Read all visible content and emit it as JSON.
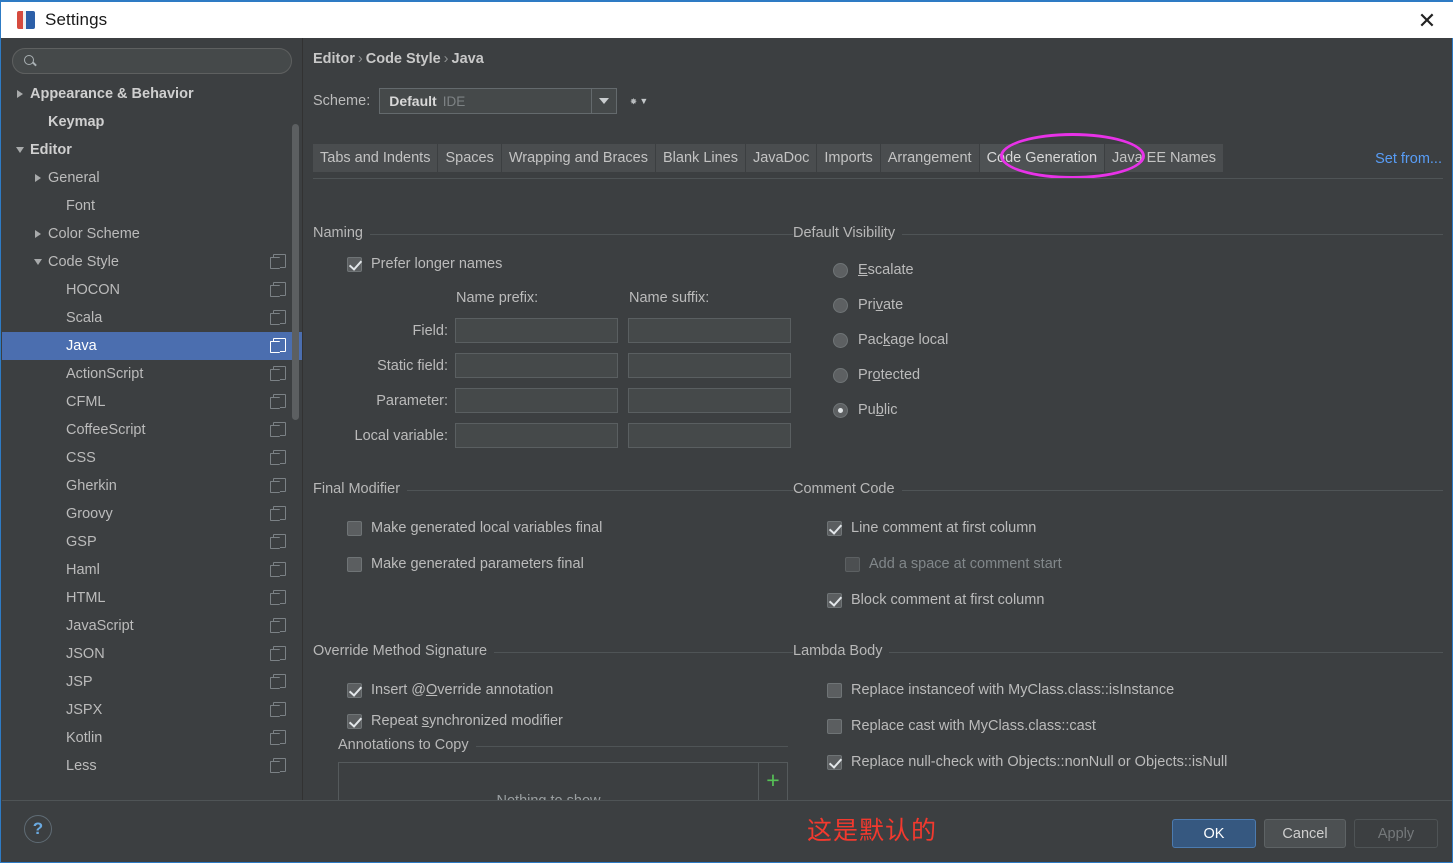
{
  "window": {
    "title": "Settings",
    "close_icon": "close-icon",
    "app_icon": "intellij-logo"
  },
  "sidebar": {
    "search": {
      "value": "",
      "placeholder": "",
      "icon": "search-icon"
    },
    "items": [
      {
        "label": "Appearance & Behavior",
        "indent": 0,
        "arrow": "right",
        "bold": true,
        "copy": false,
        "selected": false
      },
      {
        "label": "Keymap",
        "indent": 1,
        "arrow": "none",
        "bold": true,
        "copy": false,
        "selected": false
      },
      {
        "label": "Editor",
        "indent": 0,
        "arrow": "down",
        "bold": true,
        "copy": false,
        "selected": false
      },
      {
        "label": "General",
        "indent": 1,
        "arrow": "right",
        "bold": false,
        "copy": false,
        "selected": false
      },
      {
        "label": "Font",
        "indent": 2,
        "arrow": "none",
        "bold": false,
        "copy": false,
        "selected": false
      },
      {
        "label": "Color Scheme",
        "indent": 1,
        "arrow": "right",
        "bold": false,
        "copy": false,
        "selected": false
      },
      {
        "label": "Code Style",
        "indent": 1,
        "arrow": "down",
        "bold": false,
        "copy": true,
        "selected": false
      },
      {
        "label": "HOCON",
        "indent": 2,
        "arrow": "none",
        "bold": false,
        "copy": true,
        "selected": false
      },
      {
        "label": "Scala",
        "indent": 2,
        "arrow": "none",
        "bold": false,
        "copy": true,
        "selected": false
      },
      {
        "label": "Java",
        "indent": 2,
        "arrow": "none",
        "bold": false,
        "copy": true,
        "selected": true
      },
      {
        "label": "ActionScript",
        "indent": 2,
        "arrow": "none",
        "bold": false,
        "copy": true,
        "selected": false
      },
      {
        "label": "CFML",
        "indent": 2,
        "arrow": "none",
        "bold": false,
        "copy": true,
        "selected": false
      },
      {
        "label": "CoffeeScript",
        "indent": 2,
        "arrow": "none",
        "bold": false,
        "copy": true,
        "selected": false
      },
      {
        "label": "CSS",
        "indent": 2,
        "arrow": "none",
        "bold": false,
        "copy": true,
        "selected": false
      },
      {
        "label": "Gherkin",
        "indent": 2,
        "arrow": "none",
        "bold": false,
        "copy": true,
        "selected": false
      },
      {
        "label": "Groovy",
        "indent": 2,
        "arrow": "none",
        "bold": false,
        "copy": true,
        "selected": false
      },
      {
        "label": "GSP",
        "indent": 2,
        "arrow": "none",
        "bold": false,
        "copy": true,
        "selected": false
      },
      {
        "label": "Haml",
        "indent": 2,
        "arrow": "none",
        "bold": false,
        "copy": true,
        "selected": false
      },
      {
        "label": "HTML",
        "indent": 2,
        "arrow": "none",
        "bold": false,
        "copy": true,
        "selected": false
      },
      {
        "label": "JavaScript",
        "indent": 2,
        "arrow": "none",
        "bold": false,
        "copy": true,
        "selected": false
      },
      {
        "label": "JSON",
        "indent": 2,
        "arrow": "none",
        "bold": false,
        "copy": true,
        "selected": false
      },
      {
        "label": "JSP",
        "indent": 2,
        "arrow": "none",
        "bold": false,
        "copy": true,
        "selected": false
      },
      {
        "label": "JSPX",
        "indent": 2,
        "arrow": "none",
        "bold": false,
        "copy": true,
        "selected": false
      },
      {
        "label": "Kotlin",
        "indent": 2,
        "arrow": "none",
        "bold": false,
        "copy": true,
        "selected": false
      },
      {
        "label": "Less",
        "indent": 2,
        "arrow": "none",
        "bold": false,
        "copy": true,
        "selected": false
      }
    ]
  },
  "header": {
    "breadcrumb": [
      "Editor",
      "Code Style",
      "Java"
    ],
    "breadcrumb_separator": "›",
    "scheme_label": "Scheme:",
    "scheme_value": "Default",
    "scheme_scope": "IDE",
    "gear_icon": "gear-icon",
    "set_from_link": "Set from..."
  },
  "tabs": [
    {
      "label": "Tabs and Indents",
      "active": false
    },
    {
      "label": "Spaces",
      "active": false
    },
    {
      "label": "Wrapping and Braces",
      "active": false
    },
    {
      "label": "Blank Lines",
      "active": false
    },
    {
      "label": "JavaDoc",
      "active": false
    },
    {
      "label": "Imports",
      "active": false
    },
    {
      "label": "Arrangement",
      "active": false
    },
    {
      "label": "Code Generation",
      "active": true
    },
    {
      "label": "Java EE Names",
      "active": false
    }
  ],
  "annotation": {
    "highlight_color": "#e832e8",
    "tab_highlighted": "Code Generation"
  },
  "naming": {
    "group_title": "Naming",
    "prefer_longer_names": {
      "label": "Prefer longer names",
      "checked": true
    },
    "col_prefix": "Name prefix:",
    "col_suffix": "Name suffix:",
    "rows": [
      {
        "label": "Field:",
        "prefix": "",
        "suffix": ""
      },
      {
        "label": "Static field:",
        "prefix": "",
        "suffix": ""
      },
      {
        "label": "Parameter:",
        "prefix": "",
        "suffix": ""
      },
      {
        "label": "Local variable:",
        "prefix": "",
        "suffix": ""
      }
    ]
  },
  "default_visibility": {
    "group_title": "Default Visibility",
    "options": [
      {
        "label": "Escalate",
        "mnemonic": "E",
        "selected": false
      },
      {
        "label": "Private",
        "mnemonic": "v",
        "selected": false
      },
      {
        "label": "Package local",
        "mnemonic": "k",
        "selected": false
      },
      {
        "label": "Protected",
        "mnemonic": "o",
        "selected": false
      },
      {
        "label": "Public",
        "mnemonic": "b",
        "selected": true
      }
    ]
  },
  "final_modifier": {
    "group_title": "Final Modifier",
    "items": [
      {
        "label": "Make generated local variables final",
        "checked": false,
        "enabled": true
      },
      {
        "label": "Make generated parameters final",
        "checked": false,
        "enabled": true
      }
    ]
  },
  "comment_code": {
    "group_title": "Comment Code",
    "items": [
      {
        "label": "Line comment at first column",
        "checked": true,
        "enabled": true,
        "indent": false
      },
      {
        "label": "Add a space at comment start",
        "checked": false,
        "enabled": false,
        "indent": true
      },
      {
        "label": "Block comment at first column",
        "checked": true,
        "enabled": true,
        "indent": false
      }
    ]
  },
  "override_method_signature": {
    "group_title": "Override Method Signature",
    "items": [
      {
        "label": "Insert @Override annotation",
        "mnemonic": "O",
        "checked": true
      },
      {
        "label": "Repeat synchronized modifier",
        "mnemonic": "s",
        "checked": true
      }
    ],
    "annotations_to_copy": {
      "group_title": "Annotations to Copy",
      "empty_text": "Nothing to show",
      "add_icon": "plus-icon",
      "remove_icon": "minus-icon"
    }
  },
  "lambda_body": {
    "group_title": "Lambda Body",
    "items": [
      {
        "label": "Replace instanceof with MyClass.class::isInstance",
        "checked": false
      },
      {
        "label": "Replace cast with MyClass.class::cast",
        "checked": false
      },
      {
        "label": "Replace null-check with Objects::nonNull or Objects::isNull",
        "checked": true
      }
    ]
  },
  "footer": {
    "help_icon": "?",
    "note": "这是默认的",
    "note_color": "#f2392e",
    "ok": "OK",
    "cancel": "Cancel",
    "apply": "Apply"
  }
}
